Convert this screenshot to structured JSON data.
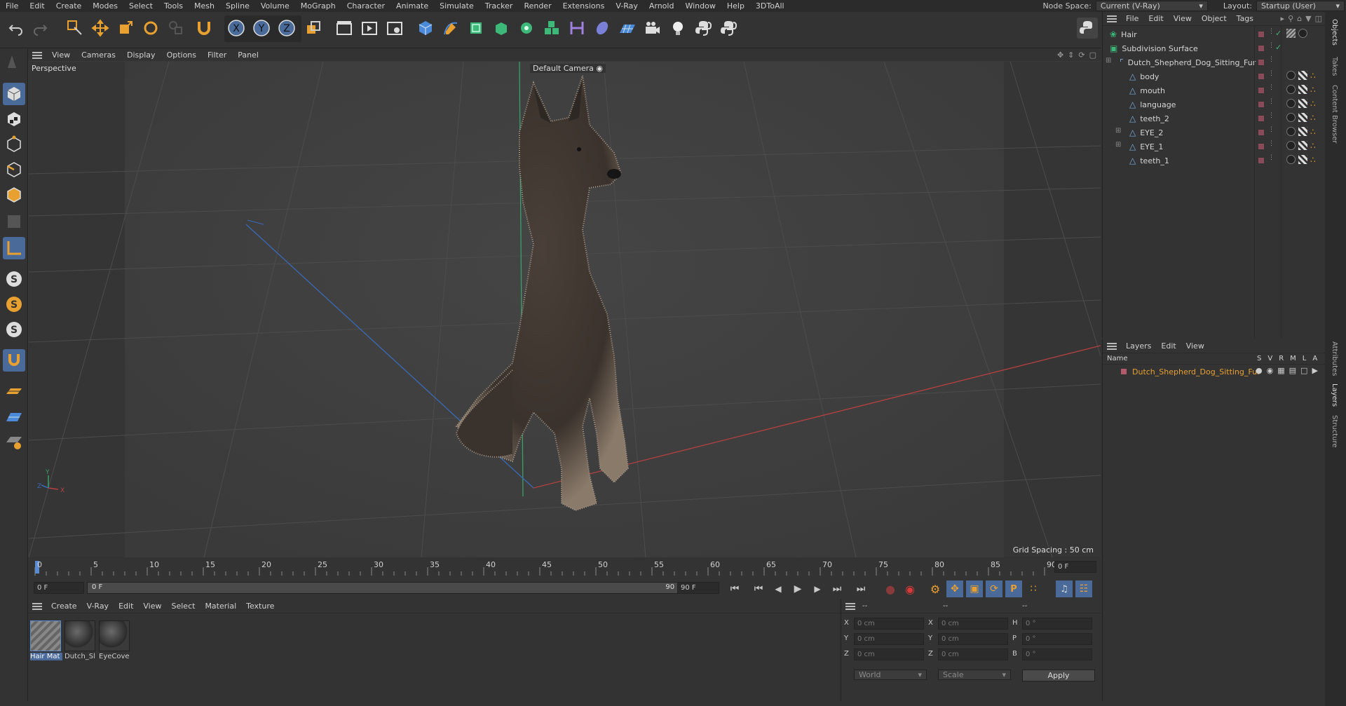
{
  "menubar": {
    "items": [
      "File",
      "Edit",
      "Create",
      "Modes",
      "Select",
      "Tools",
      "Mesh",
      "Spline",
      "Volume",
      "MoGraph",
      "Character",
      "Animate",
      "Simulate",
      "Tracker",
      "Render",
      "Extensions",
      "V-Ray",
      "Arnold",
      "Window",
      "Help",
      "3DToAll"
    ],
    "node_space_label": "Node Space:",
    "node_space_value": "Current (V-Ray)",
    "layout_label": "Layout:",
    "layout_value": "Startup (User)"
  },
  "viewport": {
    "menu": [
      "View",
      "Cameras",
      "Display",
      "Options",
      "Filter",
      "Panel"
    ],
    "view_name": "Perspective",
    "camera_label": "Default Camera",
    "camera_icon": "camera-target-icon",
    "grid_spacing": "Grid Spacing : 50 cm",
    "axis_x": "X",
    "axis_y": "Y",
    "axis_z": "Z"
  },
  "timeline": {
    "ticks": [
      "0",
      "5",
      "10",
      "15",
      "20",
      "25",
      "30",
      "35",
      "40",
      "45",
      "50",
      "55",
      "60",
      "65",
      "70",
      "75",
      "80",
      "85",
      "90"
    ],
    "current_frame": "0 F",
    "start_frame": "0 F",
    "range_start": "0 F",
    "range_end": "90 F",
    "end_frame": "90 F"
  },
  "materials": {
    "menu": [
      "Create",
      "V-Ray",
      "Edit",
      "View",
      "Select",
      "Material",
      "Texture"
    ],
    "items": [
      {
        "name": "Hair Mat",
        "kind": "hair"
      },
      {
        "name": "Dutch_Sl",
        "kind": "sphere"
      },
      {
        "name": "EyeCove",
        "kind": "sphere"
      }
    ]
  },
  "coordinates": {
    "headers": [
      "--",
      "--",
      "--"
    ],
    "rows": [
      {
        "a": "X",
        "av": "0 cm",
        "b": "X",
        "bv": "0 cm",
        "c": "H",
        "cv": "0 °"
      },
      {
        "a": "Y",
        "av": "0 cm",
        "b": "Y",
        "bv": "0 cm",
        "c": "P",
        "cv": "0 °"
      },
      {
        "a": "Z",
        "av": "0 cm",
        "b": "Z",
        "bv": "0 cm",
        "c": "B",
        "cv": "0 °"
      }
    ],
    "space": "World",
    "mode": "Scale",
    "apply": "Apply"
  },
  "objects": {
    "menu": [
      "File",
      "Edit",
      "View",
      "Object",
      "Tags"
    ],
    "items": [
      {
        "name": "Hair",
        "indent": 0,
        "icon": "hair-icon"
      },
      {
        "name": "Subdivision Surface",
        "indent": 0,
        "icon": "subdivision-icon"
      },
      {
        "name": "Dutch_Shepherd_Dog_Sitting_Fur",
        "indent": 1,
        "icon": "null-object-icon"
      },
      {
        "name": "body",
        "indent": 2,
        "icon": "polygon-object-icon"
      },
      {
        "name": "mouth",
        "indent": 2,
        "icon": "polygon-object-icon"
      },
      {
        "name": "language",
        "indent": 2,
        "icon": "polygon-object-icon"
      },
      {
        "name": "teeth_2",
        "indent": 2,
        "icon": "polygon-object-icon"
      },
      {
        "name": "EYE_2",
        "indent": 2,
        "icon": "polygon-object-icon"
      },
      {
        "name": "EYE_1",
        "indent": 2,
        "icon": "polygon-object-icon"
      },
      {
        "name": "teeth_1",
        "indent": 2,
        "icon": "polygon-object-icon"
      }
    ]
  },
  "layers": {
    "menu": [
      "Layers",
      "Edit",
      "View"
    ],
    "col_name": "Name",
    "cols": [
      "S",
      "V",
      "R",
      "M",
      "L",
      "A"
    ],
    "items": [
      {
        "name": "Dutch_Shepherd_Dog_Sitting_Fur",
        "color": "#b05a6a"
      }
    ]
  },
  "right_tabs": [
    "Objects",
    "Takes",
    "Content Browser",
    "Attributes",
    "Layers",
    "Structure"
  ],
  "colors": {
    "accent": "#e8a030",
    "selection_blue": "#4a7ab8",
    "layer_text": "#e8a030"
  }
}
